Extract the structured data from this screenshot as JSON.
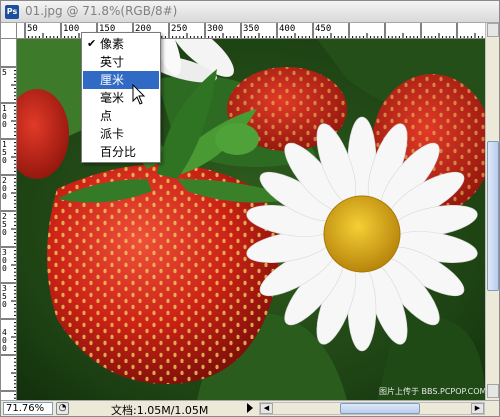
{
  "window": {
    "title": "01.jpg @ 71.8%(RGB/8#)",
    "app_icon": "photoshop-icon"
  },
  "ruler_top": {
    "labels": [
      "50",
      "100",
      "150",
      "200",
      "250",
      "300",
      "350",
      "400",
      "450"
    ]
  },
  "ruler_left": {
    "labels": [
      "5",
      "1 0 0",
      "1 5 0",
      "2 0 0",
      "2 5 0",
      "3 0 0",
      "3 5 0",
      "4 0 0"
    ]
  },
  "context_menu": {
    "items": [
      {
        "label": "像素",
        "checked": true
      },
      {
        "label": "英寸",
        "checked": false
      },
      {
        "label": "厘米",
        "checked": false,
        "highlighted": true
      },
      {
        "label": "毫米",
        "checked": false
      },
      {
        "label": "点",
        "checked": false
      },
      {
        "label": "派卡",
        "checked": false
      },
      {
        "label": "百分比",
        "checked": false
      }
    ],
    "check_mark": "✔"
  },
  "watermark": "图片上传于  BBS.PCPOP.COM",
  "status": {
    "zoom": "71.76%",
    "doc_info": "文档:1.05M/1.05M"
  },
  "colors": {
    "menu_highlight": "#316ac5",
    "strawberry": "#d42a1e",
    "leaf": "#2f6a23",
    "daisy_center": "#e3b21a"
  }
}
